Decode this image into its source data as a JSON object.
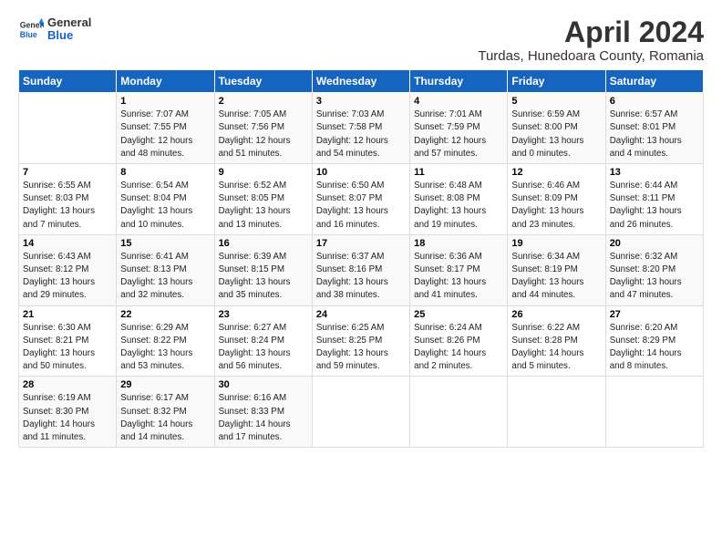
{
  "logo": {
    "general": "General",
    "blue": "Blue"
  },
  "title": "April 2024",
  "subtitle": "Turdas, Hunedoara County, Romania",
  "days_header": [
    "Sunday",
    "Monday",
    "Tuesday",
    "Wednesday",
    "Thursday",
    "Friday",
    "Saturday"
  ],
  "weeks": [
    [
      {
        "num": "",
        "info": ""
      },
      {
        "num": "1",
        "info": "Sunrise: 7:07 AM\nSunset: 7:55 PM\nDaylight: 12 hours\nand 48 minutes."
      },
      {
        "num": "2",
        "info": "Sunrise: 7:05 AM\nSunset: 7:56 PM\nDaylight: 12 hours\nand 51 minutes."
      },
      {
        "num": "3",
        "info": "Sunrise: 7:03 AM\nSunset: 7:58 PM\nDaylight: 12 hours\nand 54 minutes."
      },
      {
        "num": "4",
        "info": "Sunrise: 7:01 AM\nSunset: 7:59 PM\nDaylight: 12 hours\nand 57 minutes."
      },
      {
        "num": "5",
        "info": "Sunrise: 6:59 AM\nSunset: 8:00 PM\nDaylight: 13 hours\nand 0 minutes."
      },
      {
        "num": "6",
        "info": "Sunrise: 6:57 AM\nSunset: 8:01 PM\nDaylight: 13 hours\nand 4 minutes."
      }
    ],
    [
      {
        "num": "7",
        "info": "Sunrise: 6:55 AM\nSunset: 8:03 PM\nDaylight: 13 hours\nand 7 minutes."
      },
      {
        "num": "8",
        "info": "Sunrise: 6:54 AM\nSunset: 8:04 PM\nDaylight: 13 hours\nand 10 minutes."
      },
      {
        "num": "9",
        "info": "Sunrise: 6:52 AM\nSunset: 8:05 PM\nDaylight: 13 hours\nand 13 minutes."
      },
      {
        "num": "10",
        "info": "Sunrise: 6:50 AM\nSunset: 8:07 PM\nDaylight: 13 hours\nand 16 minutes."
      },
      {
        "num": "11",
        "info": "Sunrise: 6:48 AM\nSunset: 8:08 PM\nDaylight: 13 hours\nand 19 minutes."
      },
      {
        "num": "12",
        "info": "Sunrise: 6:46 AM\nSunset: 8:09 PM\nDaylight: 13 hours\nand 23 minutes."
      },
      {
        "num": "13",
        "info": "Sunrise: 6:44 AM\nSunset: 8:11 PM\nDaylight: 13 hours\nand 26 minutes."
      }
    ],
    [
      {
        "num": "14",
        "info": "Sunrise: 6:43 AM\nSunset: 8:12 PM\nDaylight: 13 hours\nand 29 minutes."
      },
      {
        "num": "15",
        "info": "Sunrise: 6:41 AM\nSunset: 8:13 PM\nDaylight: 13 hours\nand 32 minutes."
      },
      {
        "num": "16",
        "info": "Sunrise: 6:39 AM\nSunset: 8:15 PM\nDaylight: 13 hours\nand 35 minutes."
      },
      {
        "num": "17",
        "info": "Sunrise: 6:37 AM\nSunset: 8:16 PM\nDaylight: 13 hours\nand 38 minutes."
      },
      {
        "num": "18",
        "info": "Sunrise: 6:36 AM\nSunset: 8:17 PM\nDaylight: 13 hours\nand 41 minutes."
      },
      {
        "num": "19",
        "info": "Sunrise: 6:34 AM\nSunset: 8:19 PM\nDaylight: 13 hours\nand 44 minutes."
      },
      {
        "num": "20",
        "info": "Sunrise: 6:32 AM\nSunset: 8:20 PM\nDaylight: 13 hours\nand 47 minutes."
      }
    ],
    [
      {
        "num": "21",
        "info": "Sunrise: 6:30 AM\nSunset: 8:21 PM\nDaylight: 13 hours\nand 50 minutes."
      },
      {
        "num": "22",
        "info": "Sunrise: 6:29 AM\nSunset: 8:22 PM\nDaylight: 13 hours\nand 53 minutes."
      },
      {
        "num": "23",
        "info": "Sunrise: 6:27 AM\nSunset: 8:24 PM\nDaylight: 13 hours\nand 56 minutes."
      },
      {
        "num": "24",
        "info": "Sunrise: 6:25 AM\nSunset: 8:25 PM\nDaylight: 13 hours\nand 59 minutes."
      },
      {
        "num": "25",
        "info": "Sunrise: 6:24 AM\nSunset: 8:26 PM\nDaylight: 14 hours\nand 2 minutes."
      },
      {
        "num": "26",
        "info": "Sunrise: 6:22 AM\nSunset: 8:28 PM\nDaylight: 14 hours\nand 5 minutes."
      },
      {
        "num": "27",
        "info": "Sunrise: 6:20 AM\nSunset: 8:29 PM\nDaylight: 14 hours\nand 8 minutes."
      }
    ],
    [
      {
        "num": "28",
        "info": "Sunrise: 6:19 AM\nSunset: 8:30 PM\nDaylight: 14 hours\nand 11 minutes."
      },
      {
        "num": "29",
        "info": "Sunrise: 6:17 AM\nSunset: 8:32 PM\nDaylight: 14 hours\nand 14 minutes."
      },
      {
        "num": "30",
        "info": "Sunrise: 6:16 AM\nSunset: 8:33 PM\nDaylight: 14 hours\nand 17 minutes."
      },
      {
        "num": "",
        "info": ""
      },
      {
        "num": "",
        "info": ""
      },
      {
        "num": "",
        "info": ""
      },
      {
        "num": "",
        "info": ""
      }
    ]
  ]
}
